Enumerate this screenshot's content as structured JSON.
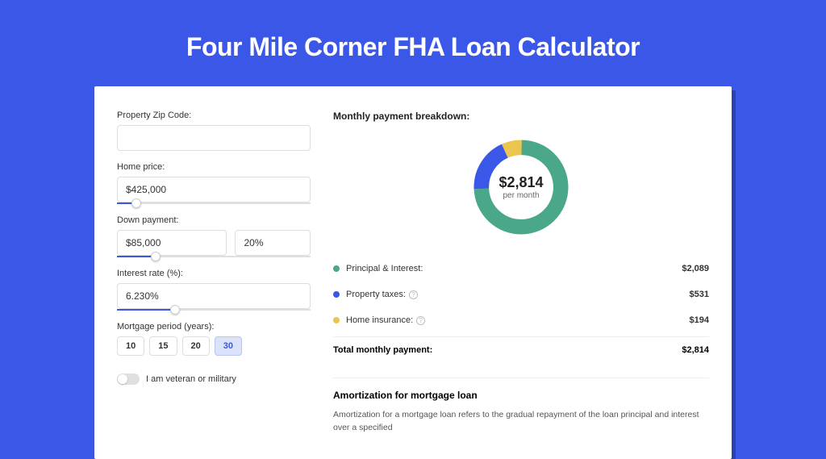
{
  "title": "Four Mile Corner FHA Loan Calculator",
  "form": {
    "zip_label": "Property Zip Code:",
    "zip_value": "",
    "home_price_label": "Home price:",
    "home_price_value": "$425,000",
    "down_payment_label": "Down payment:",
    "down_payment_value": "$85,000",
    "down_payment_pct": "20%",
    "interest_label": "Interest rate (%):",
    "interest_value": "6.230%",
    "period_label": "Mortgage period (years):",
    "periods": [
      "10",
      "15",
      "20",
      "30"
    ],
    "period_selected": "30",
    "veteran_label": "I am veteran or military"
  },
  "breakdown": {
    "title": "Monthly payment breakdown:",
    "center_amount": "$2,814",
    "center_sub": "per month",
    "items": [
      {
        "label": "Principal & Interest:",
        "value": "$2,089",
        "color": "#4aa789",
        "has_info": false
      },
      {
        "label": "Property taxes:",
        "value": "$531",
        "color": "#3a57e8",
        "has_info": true
      },
      {
        "label": "Home insurance:",
        "value": "$194",
        "color": "#eac54f",
        "has_info": true
      }
    ],
    "total_label": "Total monthly payment:",
    "total_value": "$2,814"
  },
  "chart_data": {
    "type": "pie",
    "title": "Monthly payment breakdown",
    "series": [
      {
        "name": "Principal & Interest",
        "value": 2089,
        "color": "#4aa789"
      },
      {
        "name": "Property taxes",
        "value": 531,
        "color": "#3a57e8"
      },
      {
        "name": "Home insurance",
        "value": 194,
        "color": "#eac54f"
      }
    ],
    "total": 2814,
    "center_label": "$2,814 per month"
  },
  "amort": {
    "title": "Amortization for mortgage loan",
    "text": "Amortization for a mortgage loan refers to the gradual repayment of the loan principal and interest over a specified"
  }
}
